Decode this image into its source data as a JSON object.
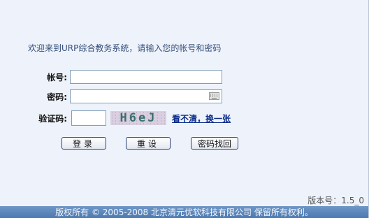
{
  "welcome_text": "欢迎来到URP综合教务系统，请输入您的帐号和密码",
  "form": {
    "username_label": "帐号:",
    "username_value": "",
    "password_label": "密码:",
    "password_value": "",
    "captcha_label": "验证码:",
    "captcha_value": "",
    "captcha_image_text": "H6eJ",
    "captcha_refresh_label": "看不清，换一张"
  },
  "buttons": {
    "login": "登录",
    "reset": "重设",
    "find_password": "密码找回"
  },
  "version_text": "版本号：1.5_0",
  "footer_text": "版权所有 © 2005-2008 北京清元优软科技有限公司 保留所有权利。",
  "icons": {
    "keyboard": "keyboard-icon"
  },
  "colors": {
    "background": "#eef3fb",
    "footer_bg": "#5b86bb",
    "link": "#0b2c8a",
    "welcome_text": "#334d7a"
  }
}
